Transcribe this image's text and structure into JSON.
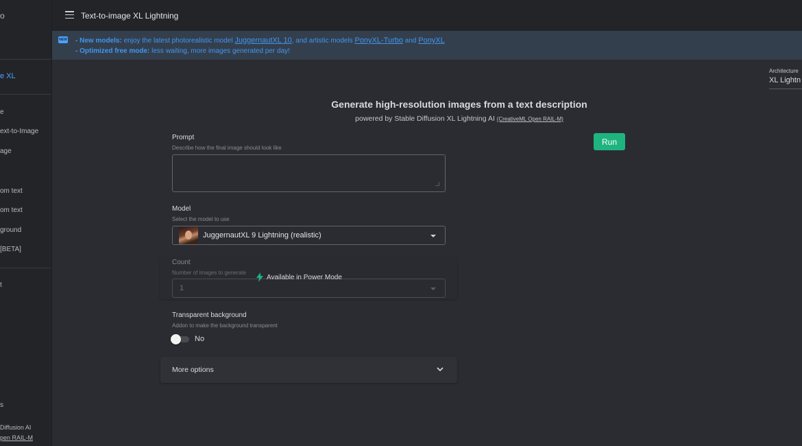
{
  "sidebar": {
    "top_fragment": "o",
    "active_item": "e XL",
    "items": [
      "e",
      "ext-to-Image",
      "age",
      "om text",
      "om text",
      "ground",
      "[BETA]",
      "t"
    ],
    "bottom_fragment": "s",
    "footer_line1": "Diffusion AI",
    "footer_line2": "pen RAIL-M"
  },
  "header": {
    "title": "Text-to-image XL Lightning"
  },
  "banner": {
    "badge": "NEW",
    "line1_bold": "- New models:",
    "line1_text": " enjoy the latest photorealistic model ",
    "link1": "JuggernautXL 10",
    "line1_mid": ", and artistic models ",
    "link2": "PonyXL-Turbo",
    "line1_and": " and ",
    "link3": "PonyXL",
    "line2_bold": "- Optimized free mode:",
    "line2_text": " less waiting, more images generated per day!"
  },
  "architecture": {
    "label": "Architecture",
    "value": "XL Lightn"
  },
  "main": {
    "heading": "Generate high-resolution images from a text description",
    "subheading": "powered by Stable Diffusion XL Lightning AI ",
    "license": "(CreativeML Open RAIL-M)",
    "run_label": "Run",
    "prompt": {
      "label": "Prompt",
      "help": "Describe how the final image should look like",
      "value": ""
    },
    "model": {
      "label": "Model",
      "help": "Select the model to use",
      "selected": "JuggernautXL 9 Lightning (realistic)"
    },
    "count": {
      "label": "Count",
      "help": "Number of images to generate",
      "value": "1",
      "overlay": "Available in Power Mode"
    },
    "transparent": {
      "label": "Transparent background",
      "help": "Addon to make the background transparent",
      "state": "No"
    },
    "more_options": "More options"
  },
  "colors": {
    "accent": "#1fb47f",
    "link": "#3f97f0",
    "banner_bg": "#343f4d"
  }
}
